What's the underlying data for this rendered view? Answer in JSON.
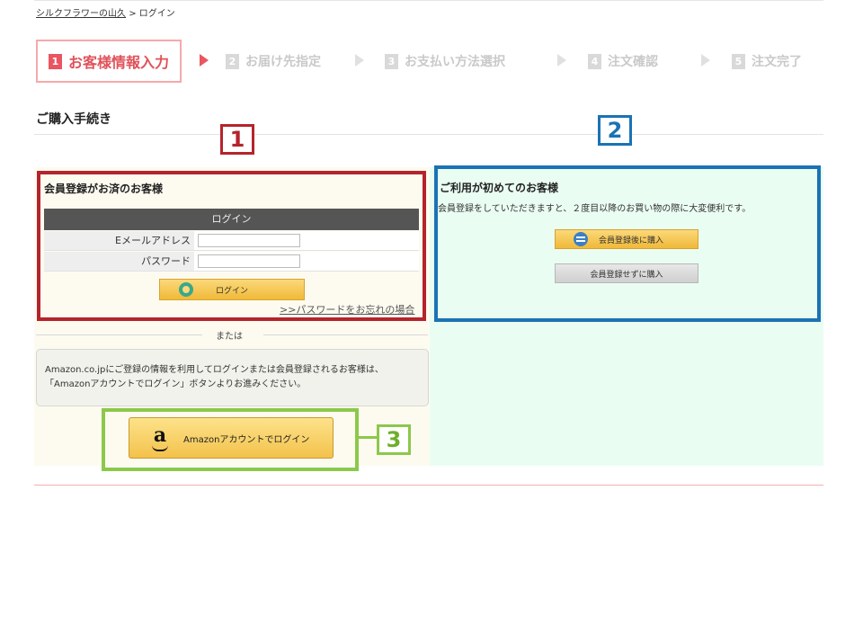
{
  "breadcrumb": {
    "home": "シルクフラワーの山久",
    "separator": ">",
    "current": "ログイン"
  },
  "steps": [
    {
      "num": "1",
      "label": "お客様情報入力"
    },
    {
      "num": "2",
      "label": "お届け先指定"
    },
    {
      "num": "3",
      "label": "お支払い方法選択"
    },
    {
      "num": "4",
      "label": "注文確認"
    },
    {
      "num": "5",
      "label": "注文完了"
    }
  ],
  "page_title": "ご購入手続き",
  "callouts": {
    "one": "1",
    "two": "2",
    "three": "3"
  },
  "member": {
    "heading": "会員登録がお済のお客様",
    "table_header": "ログイン",
    "email_label": "Eメールアドレス",
    "email_value": "",
    "password_label": "パスワード",
    "password_value": "",
    "login_button": "ログイン",
    "forgot_link": ">>パスワードをお忘れの場合"
  },
  "guest": {
    "heading": "ご利用が初めてのお客様",
    "description": "会員登録をしていただきますと、２度目以降のお買い物の際に大変便利です。",
    "register_button": "会員登録後に購入",
    "guest_button": "会員登録せずに購入"
  },
  "or_text": "または",
  "amazon": {
    "note_line1": "Amazon.co.jpにご登録の情報を利用してログインまたは会員登録されるお客様は、",
    "note_line2": "「Amazonアカウントでログイン」ボタンよりお進みください。",
    "button_logo": "a",
    "button_label": "Amazonアカウントでログイン"
  },
  "colors": {
    "accent": "#ea5561",
    "callout_red": "#b5242c",
    "callout_blue": "#1a73b4",
    "callout_green": "#8cc84b"
  },
  "icons": [
    "gear-icon",
    "member-icon",
    "amazon-logo-icon"
  ]
}
